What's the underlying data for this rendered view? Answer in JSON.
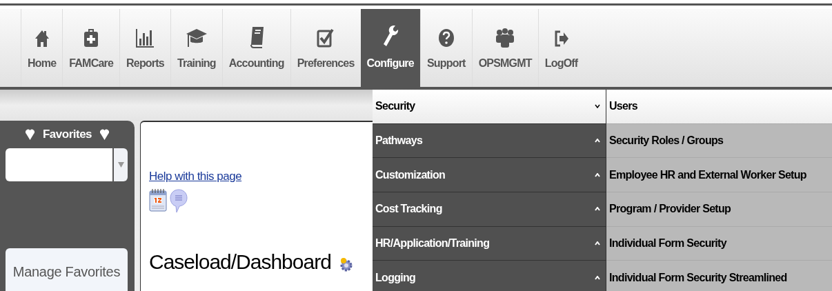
{
  "nav": [
    {
      "label": "Home",
      "selected": false
    },
    {
      "label": "FAMCare",
      "selected": false
    },
    {
      "label": "Reports",
      "selected": false
    },
    {
      "label": "Training",
      "selected": false
    },
    {
      "label": "Accounting",
      "selected": false
    },
    {
      "label": "Preferences",
      "selected": false
    },
    {
      "label": "Configure",
      "selected": true
    },
    {
      "label": "Support",
      "selected": false
    },
    {
      "label": "OPSMGMT",
      "selected": false
    },
    {
      "label": "LogOff",
      "selected": false
    }
  ],
  "sidebar": {
    "title": "Favorites",
    "button": "Manage Favorites"
  },
  "main": {
    "help_link": "Help with this page",
    "heading": "Caseload/Dashboard"
  },
  "menu": {
    "categories": [
      {
        "label": "Security",
        "selected": true,
        "expanded": true
      },
      {
        "label": "Pathways",
        "selected": false,
        "expanded": false
      },
      {
        "label": "Customization",
        "selected": false,
        "expanded": false
      },
      {
        "label": "Cost Tracking",
        "selected": false,
        "expanded": false
      },
      {
        "label": "HR/Application/Training",
        "selected": false,
        "expanded": false
      },
      {
        "label": "Logging",
        "selected": false,
        "expanded": false
      }
    ],
    "items": [
      {
        "label": "Users",
        "selected": true
      },
      {
        "label": "Security Roles / Groups",
        "selected": false
      },
      {
        "label": "Employee HR and External Worker Setup",
        "selected": false
      },
      {
        "label": "Program / Provider Setup",
        "selected": false
      },
      {
        "label": "Individual Form Security",
        "selected": false
      },
      {
        "label": "Individual Form Security Streamlined",
        "selected": false
      }
    ]
  }
}
